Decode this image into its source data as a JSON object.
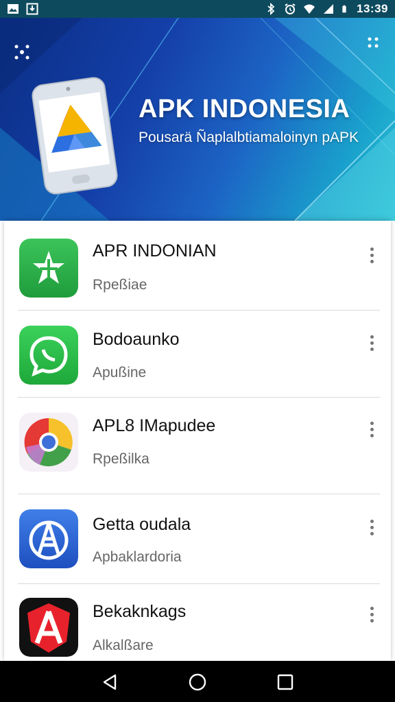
{
  "status_bar": {
    "time": "13:39",
    "left_icons": [
      "image-notification-icon",
      "download-notification-icon"
    ],
    "right_icons": [
      "bluetooth-icon",
      "alarm-icon",
      "wifi-icon",
      "signal-icon",
      "battery-icon"
    ]
  },
  "banner": {
    "title": "APK INDONESIA",
    "subtitle": "Pousarä Ñaplalbtiamaloinyn pAPK"
  },
  "apps": [
    {
      "name": "APR INDONIAN",
      "sub": "Rpeßiae",
      "icon": "green-star-icon",
      "color": "#2fb34a"
    },
    {
      "name": "Bodoaunko",
      "sub": "Apußine",
      "icon": "green-chat-icon",
      "color": "#27b543"
    },
    {
      "name": "APL8 IMapudee",
      "sub": "Rpeßilka",
      "icon": "chrome-style-icon",
      "color": "#e53935"
    },
    {
      "name": "Getta oudala",
      "sub": "Apbaklardoria",
      "icon": "blue-compass-icon",
      "color": "#2a63d6"
    },
    {
      "name": "Bekaknkags",
      "sub": "Alkalßare",
      "icon": "red-a-icon",
      "color": "#e8222c"
    }
  ],
  "nav": {
    "back": "back-icon",
    "home": "home-icon",
    "recents": "recents-icon"
  }
}
